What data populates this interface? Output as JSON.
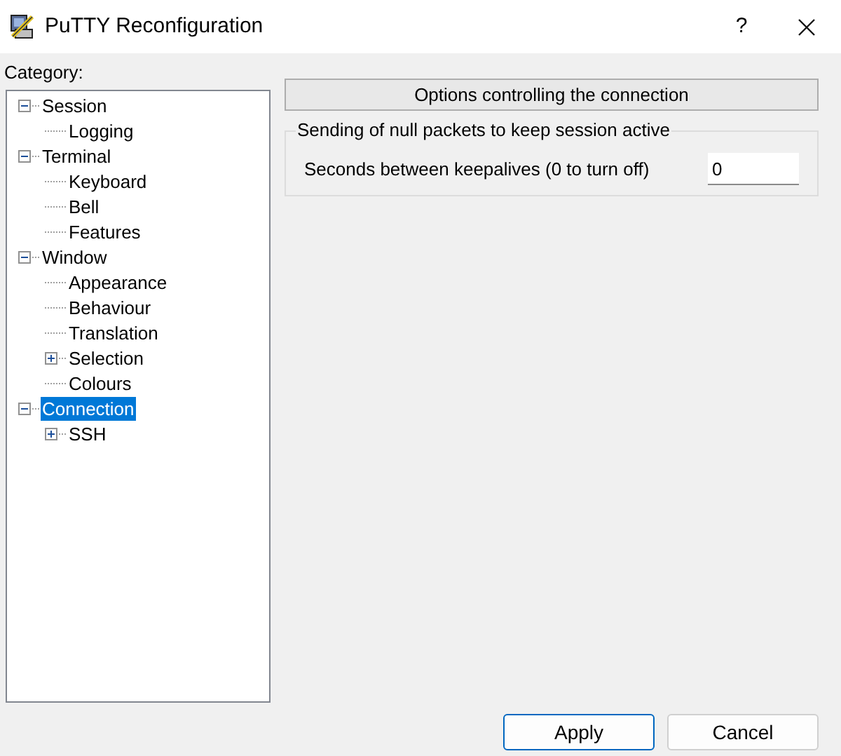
{
  "window": {
    "title": "PuTTY Reconfiguration",
    "help": "?"
  },
  "category_label": "Category:",
  "tree": [
    {
      "label": "Session",
      "expanded": true,
      "selected": false,
      "children": [
        {
          "label": "Logging",
          "selected": false
        }
      ]
    },
    {
      "label": "Terminal",
      "expanded": true,
      "selected": false,
      "children": [
        {
          "label": "Keyboard",
          "selected": false
        },
        {
          "label": "Bell",
          "selected": false
        },
        {
          "label": "Features",
          "selected": false
        }
      ]
    },
    {
      "label": "Window",
      "expanded": true,
      "selected": false,
      "children": [
        {
          "label": "Appearance",
          "selected": false
        },
        {
          "label": "Behaviour",
          "selected": false
        },
        {
          "label": "Translation",
          "selected": false
        },
        {
          "label": "Selection",
          "expanded": false,
          "selected": false
        },
        {
          "label": "Colours",
          "selected": false
        }
      ]
    },
    {
      "label": "Connection",
      "expanded": true,
      "selected": true,
      "children": [
        {
          "label": "SSH",
          "expanded": false,
          "selected": false
        }
      ]
    }
  ],
  "panel": {
    "header": "Options controlling the connection",
    "group": {
      "title": "Sending of null packets to keep session active",
      "field_label": "Seconds between keepalives (0 to turn off)",
      "value": "0"
    }
  },
  "buttons": [
    {
      "label": "Apply",
      "default": true
    },
    {
      "label": "Cancel",
      "default": false
    }
  ]
}
